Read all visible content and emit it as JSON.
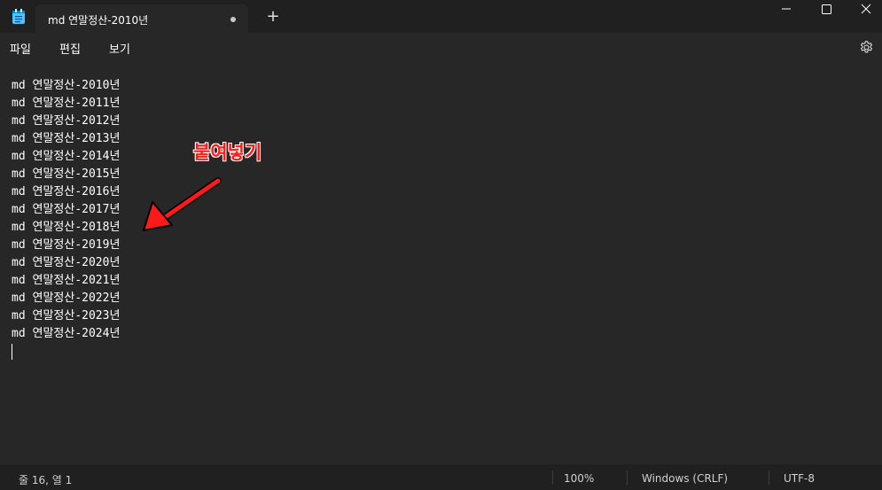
{
  "window": {
    "tab_title": "md 연말정산-2010년",
    "new_tab_label": "+",
    "icons": [
      "notepad-icon",
      "minimize-icon",
      "maximize-icon",
      "close-icon",
      "settings-gear-icon"
    ]
  },
  "menu": {
    "file": "파일",
    "edit": "편집",
    "view": "보기"
  },
  "editor": {
    "lines": [
      "md 연말정산-2010년",
      "md 연말정산-2011년",
      "md 연말정산-2012년",
      "md 연말정산-2013년",
      "md 연말정산-2014년",
      "md 연말정산-2015년",
      "md 연말정산-2016년",
      "md 연말정산-2017년",
      "md 연말정산-2018년",
      "md 연말정산-2019년",
      "md 연말정산-2020년",
      "md 연말정산-2021년",
      "md 연말정산-2022년",
      "md 연말정산-2023년",
      "md 연말정산-2024년"
    ],
    "annotation": "붙여넣기",
    "annotation_color": "#ff1a1a"
  },
  "status": {
    "position": "줄 16, 열 1",
    "zoom": "100%",
    "line_ending": "Windows (CRLF)",
    "encoding": "UTF-8"
  }
}
